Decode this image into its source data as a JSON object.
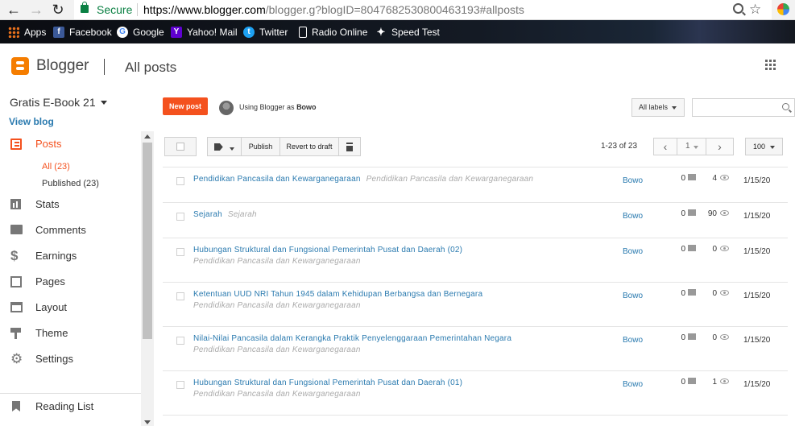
{
  "browser": {
    "secure_label": "Secure",
    "url_host": "https://www.blogger.com",
    "url_rest": "/blogger.g?blogID=8047682530800463193#allposts"
  },
  "bookmarks": [
    {
      "label": "Apps",
      "icon": "apps-grid-icon",
      "color": "#e8711c"
    },
    {
      "label": "Facebook",
      "icon": "facebook-icon",
      "color": "#3b5998"
    },
    {
      "label": "Google",
      "icon": "google-icon",
      "color": "#ffffff"
    },
    {
      "label": "Yahoo! Mail",
      "icon": "yahoo-icon",
      "color": "#5f01d1"
    },
    {
      "label": "Twitter",
      "icon": "twitter-icon",
      "color": "#1da1f2"
    },
    {
      "label": "Radio Online",
      "icon": "page-icon",
      "color": "#ffffff"
    },
    {
      "label": "Speed Test",
      "icon": "speedtest-icon",
      "color": "#ffffff"
    }
  ],
  "header": {
    "brand": "Blogger",
    "title": "All posts"
  },
  "sidebar": {
    "blog_name": "Gratis E-Book 21",
    "view_blog": "View blog",
    "items": [
      {
        "label": "Posts",
        "icon": "posts-icon"
      },
      {
        "label": "Stats",
        "icon": "stats-icon"
      },
      {
        "label": "Comments",
        "icon": "comments-icon"
      },
      {
        "label": "Earnings",
        "icon": "dollar-icon"
      },
      {
        "label": "Pages",
        "icon": "pages-icon"
      },
      {
        "label": "Layout",
        "icon": "layout-icon"
      },
      {
        "label": "Theme",
        "icon": "paint-roller-icon"
      },
      {
        "label": "Settings",
        "icon": "gear-icon"
      }
    ],
    "sub_items": [
      {
        "label": "All (23)"
      },
      {
        "label": "Published (23)"
      }
    ],
    "reading_list": "Reading List"
  },
  "main": {
    "new_post": "New post",
    "using_prefix": "Using Blogger as",
    "user_name": "Bowo",
    "labels_dropdown": "All labels",
    "toolbar": {
      "publish": "Publish",
      "revert": "Revert to draft"
    },
    "pager": {
      "range": "1-23 of 23",
      "page": "1",
      "per_page": "100"
    },
    "accent": "#f4511e",
    "link_color": "#2a7aaf"
  },
  "posts": [
    {
      "title": "Pendidikan Pancasila dan Kewarganegaraan",
      "label": "Pendidikan Pancasila dan Kewarganegaraan",
      "author": "Bowo",
      "comments": "0",
      "views": "4",
      "date": "1/15/20"
    },
    {
      "title": "Sejarah",
      "label": "Sejarah",
      "author": "Bowo",
      "comments": "0",
      "views": "90",
      "date": "1/15/20"
    },
    {
      "title": "Hubungan Struktural dan Fungsional Pemerintah Pusat dan Daerah (02)",
      "label": "Pendidikan Pancasila dan Kewarganegaraan",
      "author": "Bowo",
      "comments": "0",
      "views": "0",
      "date": "1/15/20"
    },
    {
      "title": "Ketentuan UUD NRI Tahun 1945 dalam Kehidupan Berbangsa dan Bernegara",
      "label": "Pendidikan Pancasila dan Kewarganegaraan",
      "author": "Bowo",
      "comments": "0",
      "views": "0",
      "date": "1/15/20"
    },
    {
      "title": "Nilai-Nilai Pancasila dalam Kerangka Praktik Penyelenggaraan Pemerintahan Negara",
      "label": "Pendidikan Pancasila dan Kewarganegaraan",
      "author": "Bowo",
      "comments": "0",
      "views": "0",
      "date": "1/15/20"
    },
    {
      "title": "Hubungan Struktural dan Fungsional Pemerintah Pusat dan Daerah (01)",
      "label": "Pendidikan Pancasila dan Kewarganegaraan",
      "author": "Bowo",
      "comments": "0",
      "views": "1",
      "date": "1/15/20"
    }
  ]
}
